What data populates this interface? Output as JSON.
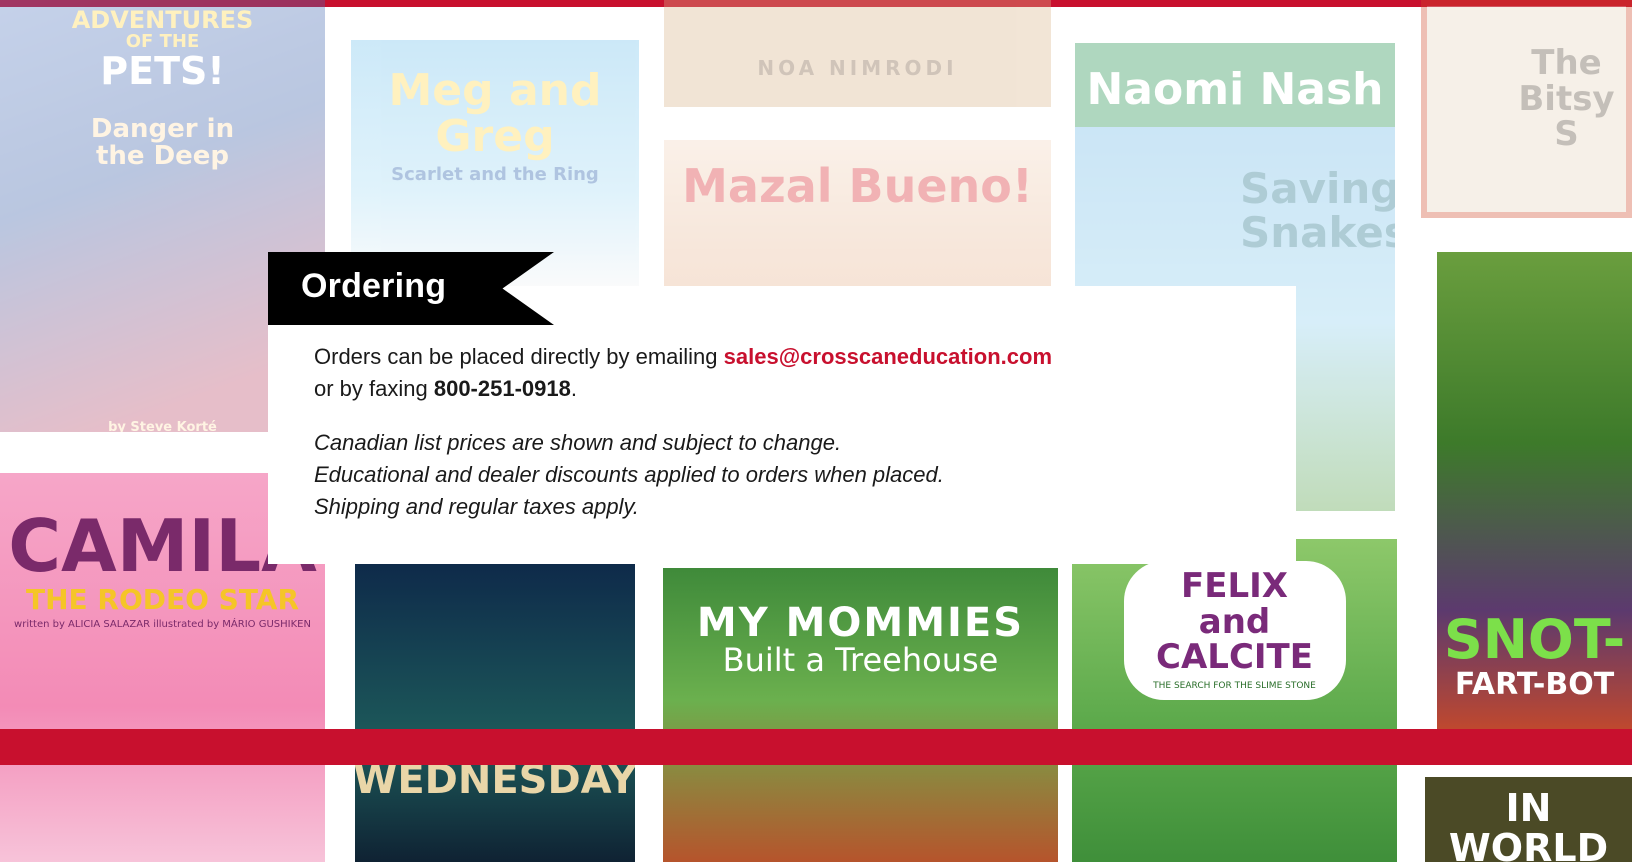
{
  "colors": {
    "accent": "#c8102e",
    "ribbon": "#000000"
  },
  "covers": {
    "pets": {
      "line1": "ADVENTURES",
      "line2": "OF THE",
      "line3": "PETS!",
      "subtitle": "Danger in the Deep",
      "credit": "by Steve Korté"
    },
    "meg": {
      "title": "Meg and Greg",
      "subtitle": "Scarlet and the Ring"
    },
    "noa": {
      "author": "NOA NIMRODI"
    },
    "mazal": {
      "title": "Mazal Bueno!"
    },
    "naomi": {
      "title": "Naomi Nash",
      "subtitle": "Saving Snakes"
    },
    "bitsy": {
      "title": "The Bitsy S"
    },
    "snot": {
      "title": "SNOT-",
      "subtitle": "FART-BOT"
    },
    "camila": {
      "title": "CAMILA",
      "subtitle": "THE RODEO STAR",
      "credit": "written by ALICIA SALAZAR  illustrated by MÁRIO GUSHIKEN"
    },
    "wednesday": {
      "title": "WEDNESDAY"
    },
    "mommies": {
      "line1": "MY MOMMIES",
      "line2": "Built a Treehouse"
    },
    "felix": {
      "title": "FELIX and CALCITE",
      "subtitle": "THE SEARCH FOR THE SLIME STONE"
    },
    "world": {
      "title": "IN WORLD"
    }
  },
  "ordering": {
    "heading": "Ordering",
    "line1_prefix": "Orders can be placed directly by emailing ",
    "email": "sales@crosscaneducation.com",
    "line2_prefix": "or by faxing ",
    "fax": "800-251-0918",
    "line2_suffix": ".",
    "notes": [
      "Canadian list prices are shown and subject to change.",
      "Educational and dealer discounts applied to orders when placed.",
      "Shipping and regular taxes apply."
    ]
  }
}
